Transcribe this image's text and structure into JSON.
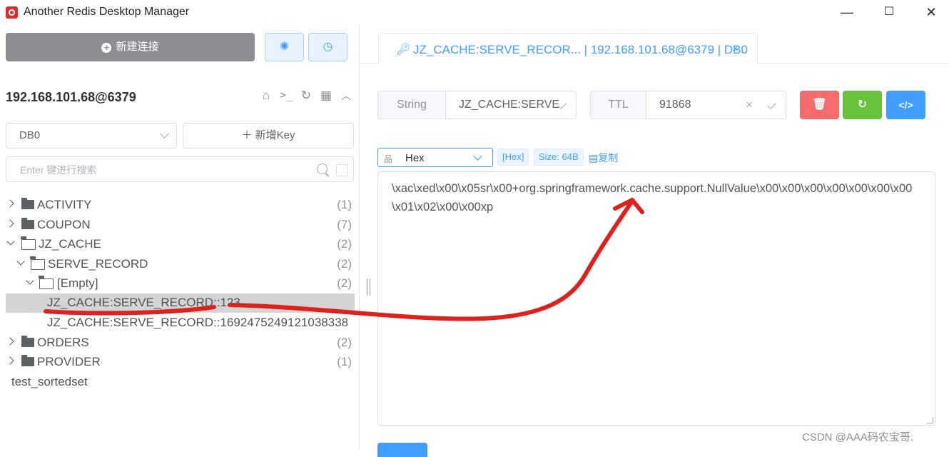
{
  "window": {
    "title": "Another Redis Desktop Manager",
    "minimize": "—",
    "maximize": "☐",
    "close": "✕"
  },
  "sidebar": {
    "new_connection": "新建连接",
    "connection_name": "192.168.101.68@6379",
    "db_select": "DB0",
    "add_key": "＋ 新增Key",
    "search_placeholder": "Enter 键进行搜索",
    "tree": [
      {
        "label": "ACTIVITY",
        "count": "(1)"
      },
      {
        "label": "COUPON",
        "count": "(7)"
      },
      {
        "label": "JZ_CACHE",
        "count": "(2)"
      },
      {
        "label": "SERVE_RECORD",
        "count": "(2)"
      },
      {
        "label": "[Empty]",
        "count": "(2)"
      },
      {
        "label": "JZ_CACHE:SERVE_RECORD::123"
      },
      {
        "label": "JZ_CACHE:SERVE_RECORD::1692475249121038338"
      },
      {
        "label": "ORDERS",
        "count": "(2)"
      },
      {
        "label": "PROVIDER",
        "count": "(1)"
      },
      {
        "label": "test_sortedset"
      }
    ]
  },
  "tab": {
    "label": "JZ_CACHE:SERVE_RECOR... | 192.168.101.68@6379 | DB0",
    "close": "×"
  },
  "key_info": {
    "type": "String",
    "key_name": "JZ_CACHE:SERVE_",
    "ttl_label": "TTL",
    "ttl_value": "91868"
  },
  "viewer": {
    "format": "Hex",
    "format_tag": "[Hex]",
    "size": "Size: 64B",
    "copy": "复制",
    "value": "\\xac\\xed\\x00\\x05sr\\x00+org.springframework.cache.support.NullValue\\x00\\x00\\x00\\x00\\x00\\x00\\x00\\x01\\x02\\x00\\x00xp"
  },
  "watermark": "CSDN @AAA码农宝哥.",
  "colors": {
    "primary": "#409eff",
    "danger": "#f56c6c",
    "success": "#67c23a",
    "annotation": "#e0201b"
  }
}
